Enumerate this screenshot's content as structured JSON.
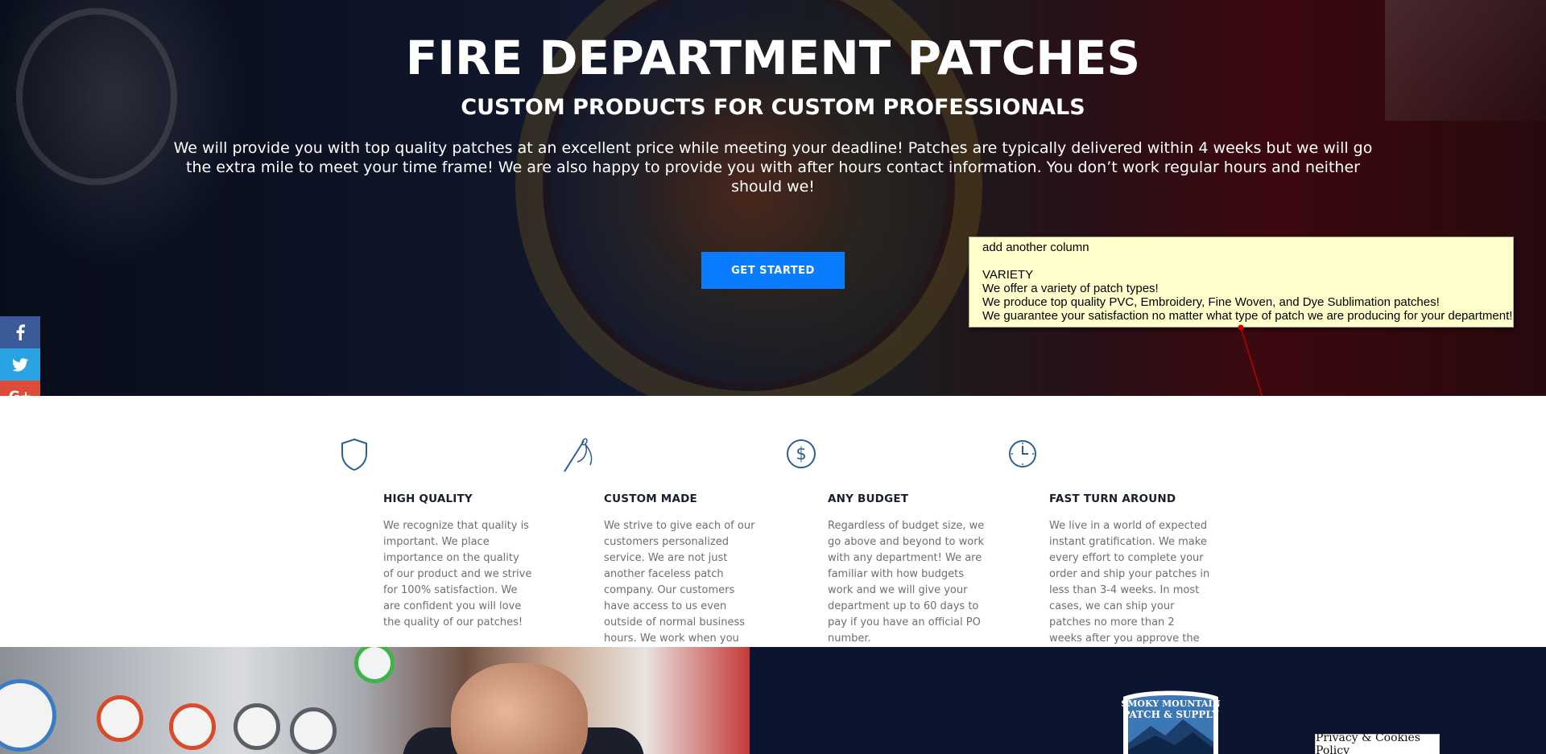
{
  "hero": {
    "title": "FIRE DEPARTMENT PATCHES",
    "subtitle": "CUSTOM PRODUCTS FOR CUSTOM PROFESSIONALS",
    "description": "We will provide you with top quality patches at an excellent price while meeting your deadline! Patches are typically delivered within 4 weeks but we will go the extra mile to meet your time frame! We are also happy to provide you with after hours contact information. You don’t work regular hours and neither should we!",
    "cta_label": "GET STARTED"
  },
  "social": {
    "facebook_icon": "facebook-icon",
    "twitter_icon": "twitter-icon",
    "googleplus_label": "G+",
    "colors": {
      "facebook": "#3b5a9a",
      "twitter": "#2aa3e5",
      "googleplus": "#dd4b39"
    }
  },
  "annotation": {
    "line1": "add another column",
    "line2": "VARIETY",
    "line3": "We offer a variety of patch types!",
    "line4": "We produce top quality PVC, Embroidery, Fine Woven, and Dye Sublimation patches!",
    "line5": "We guarantee your satisfaction no matter what type of patch we are producing for your department!"
  },
  "features": [
    {
      "icon": "shield-icon",
      "title": "HIGH QUALITY",
      "text": "We recognize that quality is important. We place importance on the quality of our product and we strive for 100% satisfaction. We are confident you will love the quality of our patches!"
    },
    {
      "icon": "needle-thread-icon",
      "title": "CUSTOM MADE",
      "text": "We strive to give each of our customers personalized service. We are not just another faceless patch company. Our customers have access to us even outside of normal business hours. We work when you work!"
    },
    {
      "icon": "dollar-icon",
      "title": "ANY BUDGET",
      "text": "Regardless of budget size, we go above and beyond to work with any department! We are familiar with how budgets work and we will give your department up to 60 days to pay if you have an official PO number."
    },
    {
      "icon": "clock-icon",
      "title": "FAST TURN AROUND",
      "text": "We live in a world of expected instant gratification. We make every effort to complete your order and ship your patches in less than 3-4 weeks. In most cases, we can ship your patches no more than 2 weeks after you approve the sample!"
    }
  ],
  "logo": {
    "line1": "SMOKY MOUNTAIN",
    "line2": "PATCH & SUPPLY"
  },
  "footer": {
    "privacy_label": "Privacy & Cookies Policy"
  },
  "colors": {
    "accent": "#0a7cff",
    "icon_blue": "#2e5d93",
    "navy": "#0b1530",
    "note_bg": "#ffffcc",
    "arrow": "#cc0000"
  }
}
